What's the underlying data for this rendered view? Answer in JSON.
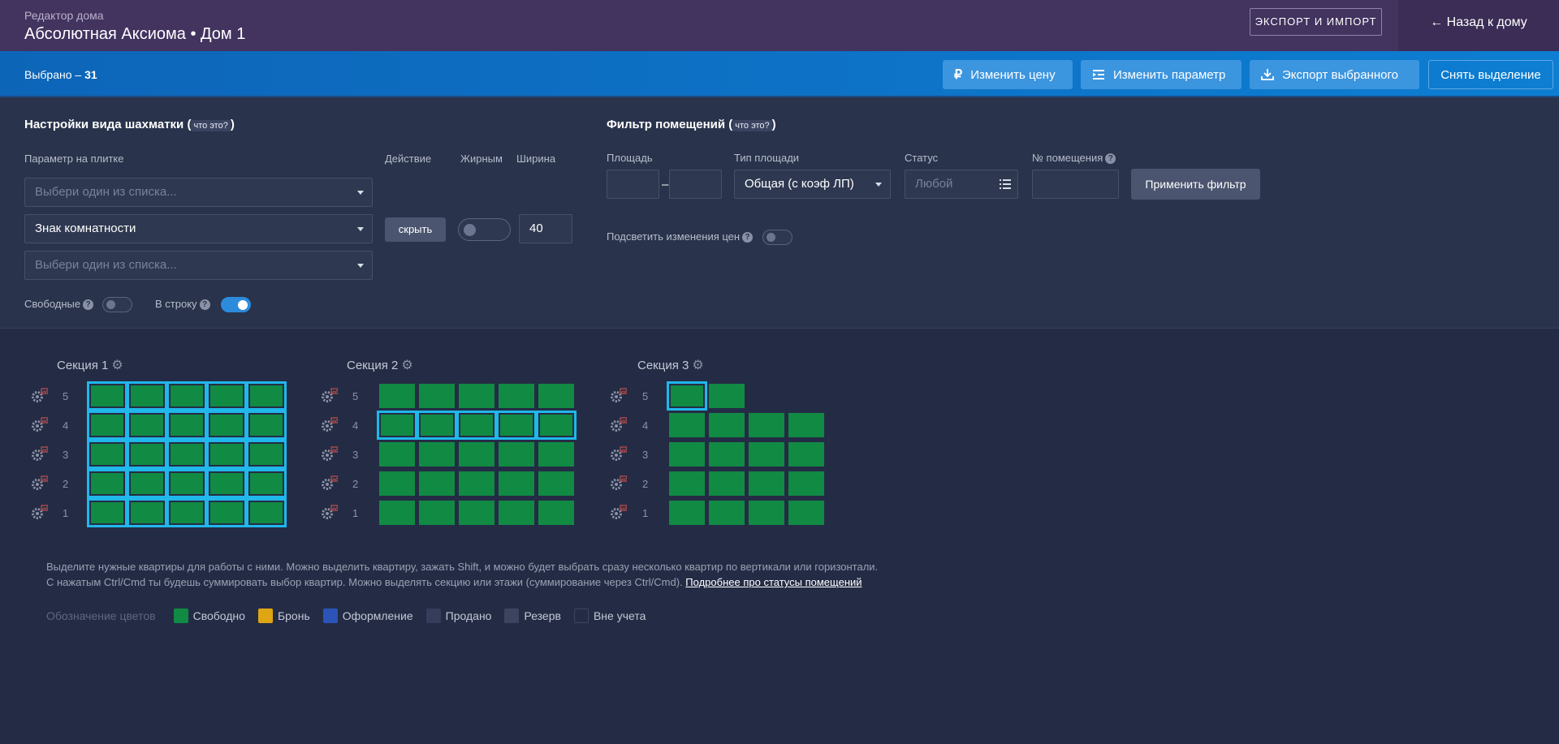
{
  "header": {
    "subtitle": "Редактор дома",
    "title": "Абсолютная Аксиома • Дом 1",
    "export_import": "ЭКСПОРТ И ИМПОРТ",
    "back": "← Назад к дому"
  },
  "selection": {
    "label": "Выбрано –",
    "count": "31",
    "change_price": "Изменить цену",
    "change_param": "Изменить параметр",
    "export_selected": "Экспорт выбранного",
    "clear_selection": "Снять выделение"
  },
  "view_settings": {
    "title": "Настройки вида шахматки",
    "whatis": "что это?",
    "col_param": "Параметр на плитке",
    "col_action": "Действие",
    "col_bold": "Жирным",
    "col_width": "Ширина",
    "select_placeholder": "Выбери один из списка...",
    "select_value": "Знак комнатности",
    "hide_button": "скрыть",
    "width_value": "40",
    "free_label": "Свободные",
    "inline_label": "В строку"
  },
  "filter": {
    "title": "Фильтр помещений",
    "whatis": "что это?",
    "area_label": "Площадь",
    "area_type_label": "Тип площади",
    "area_type_value": "Общая (с коэф ЛП)",
    "status_label": "Статус",
    "status_placeholder": "Любой",
    "room_no_label": "№ помещения",
    "apply_button": "Применить фильтр",
    "highlight_label": "Подсветить изменения цен"
  },
  "sections": [
    {
      "name": "Секция 1",
      "floors": [
        5,
        4,
        3,
        2,
        1
      ],
      "cols": 5
    },
    {
      "name": "Секция 2",
      "floors": [
        5,
        4,
        3,
        2,
        1
      ],
      "cols": 5
    },
    {
      "name": "Секция 3",
      "floors": [
        5,
        4,
        3,
        2,
        1
      ],
      "cols": 4
    }
  ],
  "help": {
    "line1": "Выделите нужные квартиры для работы с ними. Можно выделить квартиру, зажать Shift, и можно будет выбрать сразу несколько квартир по вертикали или горизонтали.",
    "line2": "С нажатым Ctrl/Cmd ты будешь суммировать выбор квартир. Можно выделять секцию или этажи (суммирование через Ctrl/Cmd).",
    "link": "Подробнее про статусы помещений"
  },
  "legend": {
    "title": "Обозначение цветов",
    "items": [
      {
        "label": "Свободно",
        "color": "#118a44"
      },
      {
        "label": "Бронь",
        "color": "#e0a512"
      },
      {
        "label": "Оформление",
        "color": "#2a54b8"
      },
      {
        "label": "Продано",
        "color": "#343d5b"
      },
      {
        "label": "Резерв",
        "color": "#3c4560"
      },
      {
        "label": "Вне учета",
        "color": "#242c45"
      }
    ]
  },
  "colors": {
    "free": "#118a44",
    "selected_outline": "#20b7ea",
    "accent": "#0d7ed2"
  }
}
